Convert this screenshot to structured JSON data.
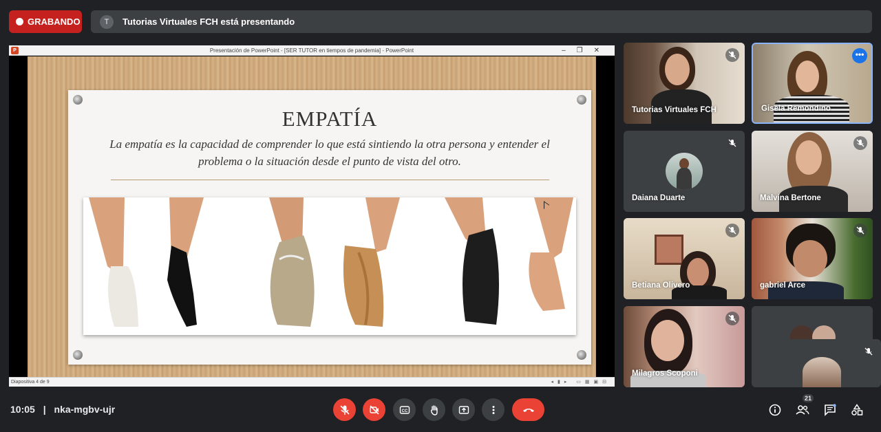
{
  "top_bar": {
    "recording_label": "GRABANDO",
    "presenter_initial": "T",
    "presenting_text": "Tutorias Virtuales FCH está presentando"
  },
  "powerpoint": {
    "window_title": "Presentación de PowerPoint - [SER TUTOR en tiempos de pandemia] - PowerPoint",
    "status_text": "Diapositiva 4 de 9",
    "slide": {
      "title": "EMPATÍA",
      "body": "La empatía es la capacidad de comprender lo que está sintiendo la otra persona y entender el problema o la situación desde el punto de vista del otro."
    }
  },
  "participants": [
    {
      "name": "Tutorias Virtuales FCH",
      "muted": true
    },
    {
      "name": "Gisela Remondino",
      "muted": false,
      "speaking": true
    },
    {
      "name": "Daiana Duarte",
      "muted": true
    },
    {
      "name": "Malvina Bertone",
      "muted": true
    },
    {
      "name": "Betiana Olivero",
      "muted": true
    },
    {
      "name": "gabriel Arce",
      "muted": true
    },
    {
      "name": "Milagros Scoponi",
      "muted": true
    }
  ],
  "bottom_bar": {
    "time": "10:05",
    "separator": "|",
    "meeting_code": "nka-mgbv-ujr",
    "participant_count": "21"
  },
  "colors": {
    "background": "#202124",
    "recording_red": "#c5221f",
    "control_red": "#ea4335",
    "active_blue": "#8ab4f8"
  }
}
